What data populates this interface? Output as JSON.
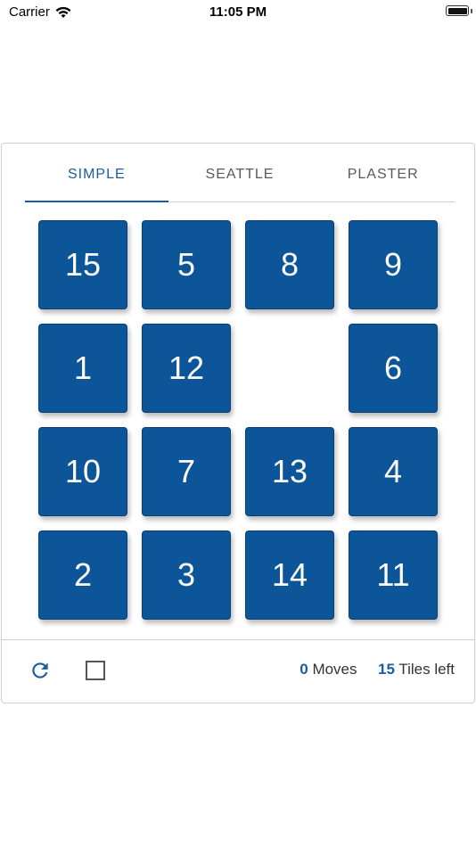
{
  "status_bar": {
    "carrier": "Carrier",
    "time": "11:05 PM"
  },
  "tabs": [
    {
      "label": "SIMPLE",
      "active": true
    },
    {
      "label": "SEATTLE",
      "active": false
    },
    {
      "label": "PLASTER",
      "active": false
    }
  ],
  "board": {
    "rows": [
      [
        "15",
        "5",
        "8",
        "9"
      ],
      [
        "1",
        "12",
        "",
        "6"
      ],
      [
        "10",
        "7",
        "13",
        "4"
      ],
      [
        "2",
        "3",
        "14",
        "11"
      ]
    ]
  },
  "footer": {
    "refresh_icon": "refresh-icon",
    "checkbox_checked": false,
    "moves_count": "0",
    "moves_label": "Moves",
    "tiles_left_count": "15",
    "tiles_left_label": "Tiles left"
  },
  "colors": {
    "accent": "#1a5da0",
    "tile": "#0d5599"
  }
}
